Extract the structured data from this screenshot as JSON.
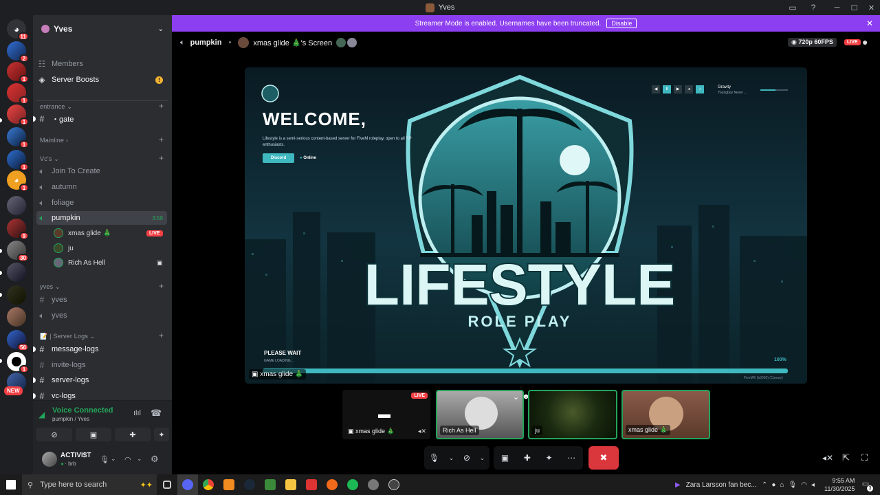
{
  "window": {
    "title": "Yves"
  },
  "rail": {
    "badges": [
      "11",
      "2",
      "1",
      "1",
      "1",
      "1",
      "1",
      "1",
      "1",
      "1",
      "9",
      "30",
      "1",
      "1",
      "56",
      "1",
      "1"
    ],
    "new_label": "NEW"
  },
  "guild": {
    "name": "Yves"
  },
  "sidebar": {
    "members": "Members",
    "server_boosts": "Server Boosts",
    "cat_entrance": "entrance",
    "gate": "・gate",
    "cat_mainline": "Mainline",
    "cat_vcs": "Vc's",
    "join_to_create": "Join To Create",
    "autumn": "autumn",
    "foliage": "foliage",
    "pumpkin": "pumpkin",
    "pumpkin_time": "3:59",
    "vusers": [
      {
        "name": "xmas glide 🎄",
        "live": "LIVE"
      },
      {
        "name": "ju"
      },
      {
        "name": "Rich As Hell"
      }
    ],
    "cat_yves": "yves",
    "yves_text": "yves",
    "yves_voice": "yves",
    "cat_server_logs": "📝 | Server Logs",
    "message_logs": "message-logs",
    "invite_logs": "invite-logs",
    "server_logs": "server-logs",
    "vc_logs": "vc-logs"
  },
  "voice": {
    "status": "Voice Connected",
    "location": "pumpkin / Yves"
  },
  "user": {
    "name": "ACTIVI$T",
    "status": "brb"
  },
  "banner": {
    "text": "Streamer Mode is enabled. Usernames have been truncated.",
    "disable": "Disable"
  },
  "call": {
    "channel": "pumpkin",
    "screen_title": "xmas glide 🎄's Screen",
    "quality": "720p 60FPS",
    "live": "LIVE"
  },
  "stream": {
    "welcome": "WELCOME,",
    "desc": "Lifestyle is a semi-serious content-based server for FiveM roleplay, open to all RP enthusiasts.",
    "discord_btn": "Discord",
    "online": "Online",
    "music_title": "Gravity",
    "music_artist": "Youngboy Never ...",
    "logo_main": "LIFESTYLE",
    "logo_sub": "ROLE PLAY",
    "please_wait": "PLEASE WAIT",
    "loading": "GAME LOADING...",
    "percent": "100%",
    "build": "FiveM® (b3095) (Canary)",
    "label": "xmas glide 🎄"
  },
  "tiles": [
    {
      "name": "xmas glide 🎄",
      "live": "LIVE"
    },
    {
      "name": "Rich As Hell"
    },
    {
      "name": "ju"
    },
    {
      "name": "xmas glide 🎄"
    }
  ],
  "taskbar": {
    "search_placeholder": "Type here to search",
    "media": "Zara Larsson fan bec...",
    "time": "9:55 AM",
    "date": "11/30/2025",
    "notif_count": "3"
  },
  "colors": {
    "accent": "#8c3ff0",
    "live": "#f23f43",
    "connected": "#23a55a",
    "teal": "#3fb8c0"
  }
}
